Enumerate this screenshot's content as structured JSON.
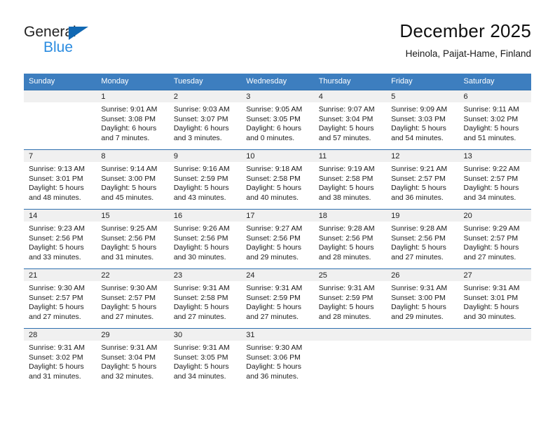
{
  "logo": {
    "word1": "General",
    "word2": "Blue",
    "triangle_color": "#1168b3",
    "word2_color": "#2b8ce0"
  },
  "header": {
    "title": "December 2025",
    "subtitle": "Heinola, Paijat-Hame, Finland"
  },
  "colors": {
    "header_blue": "#3d7ebf",
    "row_divider_blue": "#2e6fae",
    "daynum_band": "#f0f0f0"
  },
  "calendar": {
    "weekday_headers": [
      "Sunday",
      "Monday",
      "Tuesday",
      "Wednesday",
      "Thursday",
      "Friday",
      "Saturday"
    ],
    "weeks": [
      [
        {
          "day": "",
          "lines": []
        },
        {
          "day": "1",
          "lines": [
            "Sunrise: 9:01 AM",
            "Sunset: 3:08 PM",
            "Daylight: 6 hours",
            "and 7 minutes."
          ]
        },
        {
          "day": "2",
          "lines": [
            "Sunrise: 9:03 AM",
            "Sunset: 3:07 PM",
            "Daylight: 6 hours",
            "and 3 minutes."
          ]
        },
        {
          "day": "3",
          "lines": [
            "Sunrise: 9:05 AM",
            "Sunset: 3:05 PM",
            "Daylight: 6 hours",
            "and 0 minutes."
          ]
        },
        {
          "day": "4",
          "lines": [
            "Sunrise: 9:07 AM",
            "Sunset: 3:04 PM",
            "Daylight: 5 hours",
            "and 57 minutes."
          ]
        },
        {
          "day": "5",
          "lines": [
            "Sunrise: 9:09 AM",
            "Sunset: 3:03 PM",
            "Daylight: 5 hours",
            "and 54 minutes."
          ]
        },
        {
          "day": "6",
          "lines": [
            "Sunrise: 9:11 AM",
            "Sunset: 3:02 PM",
            "Daylight: 5 hours",
            "and 51 minutes."
          ]
        }
      ],
      [
        {
          "day": "7",
          "lines": [
            "Sunrise: 9:13 AM",
            "Sunset: 3:01 PM",
            "Daylight: 5 hours",
            "and 48 minutes."
          ]
        },
        {
          "day": "8",
          "lines": [
            "Sunrise: 9:14 AM",
            "Sunset: 3:00 PM",
            "Daylight: 5 hours",
            "and 45 minutes."
          ]
        },
        {
          "day": "9",
          "lines": [
            "Sunrise: 9:16 AM",
            "Sunset: 2:59 PM",
            "Daylight: 5 hours",
            "and 43 minutes."
          ]
        },
        {
          "day": "10",
          "lines": [
            "Sunrise: 9:18 AM",
            "Sunset: 2:58 PM",
            "Daylight: 5 hours",
            "and 40 minutes."
          ]
        },
        {
          "day": "11",
          "lines": [
            "Sunrise: 9:19 AM",
            "Sunset: 2:58 PM",
            "Daylight: 5 hours",
            "and 38 minutes."
          ]
        },
        {
          "day": "12",
          "lines": [
            "Sunrise: 9:21 AM",
            "Sunset: 2:57 PM",
            "Daylight: 5 hours",
            "and 36 minutes."
          ]
        },
        {
          "day": "13",
          "lines": [
            "Sunrise: 9:22 AM",
            "Sunset: 2:57 PM",
            "Daylight: 5 hours",
            "and 34 minutes."
          ]
        }
      ],
      [
        {
          "day": "14",
          "lines": [
            "Sunrise: 9:23 AM",
            "Sunset: 2:56 PM",
            "Daylight: 5 hours",
            "and 33 minutes."
          ]
        },
        {
          "day": "15",
          "lines": [
            "Sunrise: 9:25 AM",
            "Sunset: 2:56 PM",
            "Daylight: 5 hours",
            "and 31 minutes."
          ]
        },
        {
          "day": "16",
          "lines": [
            "Sunrise: 9:26 AM",
            "Sunset: 2:56 PM",
            "Daylight: 5 hours",
            "and 30 minutes."
          ]
        },
        {
          "day": "17",
          "lines": [
            "Sunrise: 9:27 AM",
            "Sunset: 2:56 PM",
            "Daylight: 5 hours",
            "and 29 minutes."
          ]
        },
        {
          "day": "18",
          "lines": [
            "Sunrise: 9:28 AM",
            "Sunset: 2:56 PM",
            "Daylight: 5 hours",
            "and 28 minutes."
          ]
        },
        {
          "day": "19",
          "lines": [
            "Sunrise: 9:28 AM",
            "Sunset: 2:56 PM",
            "Daylight: 5 hours",
            "and 27 minutes."
          ]
        },
        {
          "day": "20",
          "lines": [
            "Sunrise: 9:29 AM",
            "Sunset: 2:57 PM",
            "Daylight: 5 hours",
            "and 27 minutes."
          ]
        }
      ],
      [
        {
          "day": "21",
          "lines": [
            "Sunrise: 9:30 AM",
            "Sunset: 2:57 PM",
            "Daylight: 5 hours",
            "and 27 minutes."
          ]
        },
        {
          "day": "22",
          "lines": [
            "Sunrise: 9:30 AM",
            "Sunset: 2:57 PM",
            "Daylight: 5 hours",
            "and 27 minutes."
          ]
        },
        {
          "day": "23",
          "lines": [
            "Sunrise: 9:31 AM",
            "Sunset: 2:58 PM",
            "Daylight: 5 hours",
            "and 27 minutes."
          ]
        },
        {
          "day": "24",
          "lines": [
            "Sunrise: 9:31 AM",
            "Sunset: 2:59 PM",
            "Daylight: 5 hours",
            "and 27 minutes."
          ]
        },
        {
          "day": "25",
          "lines": [
            "Sunrise: 9:31 AM",
            "Sunset: 2:59 PM",
            "Daylight: 5 hours",
            "and 28 minutes."
          ]
        },
        {
          "day": "26",
          "lines": [
            "Sunrise: 9:31 AM",
            "Sunset: 3:00 PM",
            "Daylight: 5 hours",
            "and 29 minutes."
          ]
        },
        {
          "day": "27",
          "lines": [
            "Sunrise: 9:31 AM",
            "Sunset: 3:01 PM",
            "Daylight: 5 hours",
            "and 30 minutes."
          ]
        }
      ],
      [
        {
          "day": "28",
          "lines": [
            "Sunrise: 9:31 AM",
            "Sunset: 3:02 PM",
            "Daylight: 5 hours",
            "and 31 minutes."
          ]
        },
        {
          "day": "29",
          "lines": [
            "Sunrise: 9:31 AM",
            "Sunset: 3:04 PM",
            "Daylight: 5 hours",
            "and 32 minutes."
          ]
        },
        {
          "day": "30",
          "lines": [
            "Sunrise: 9:31 AM",
            "Sunset: 3:05 PM",
            "Daylight: 5 hours",
            "and 34 minutes."
          ]
        },
        {
          "day": "31",
          "lines": [
            "Sunrise: 9:30 AM",
            "Sunset: 3:06 PM",
            "Daylight: 5 hours",
            "and 36 minutes."
          ]
        },
        {
          "day": "",
          "lines": []
        },
        {
          "day": "",
          "lines": []
        },
        {
          "day": "",
          "lines": []
        }
      ]
    ]
  }
}
